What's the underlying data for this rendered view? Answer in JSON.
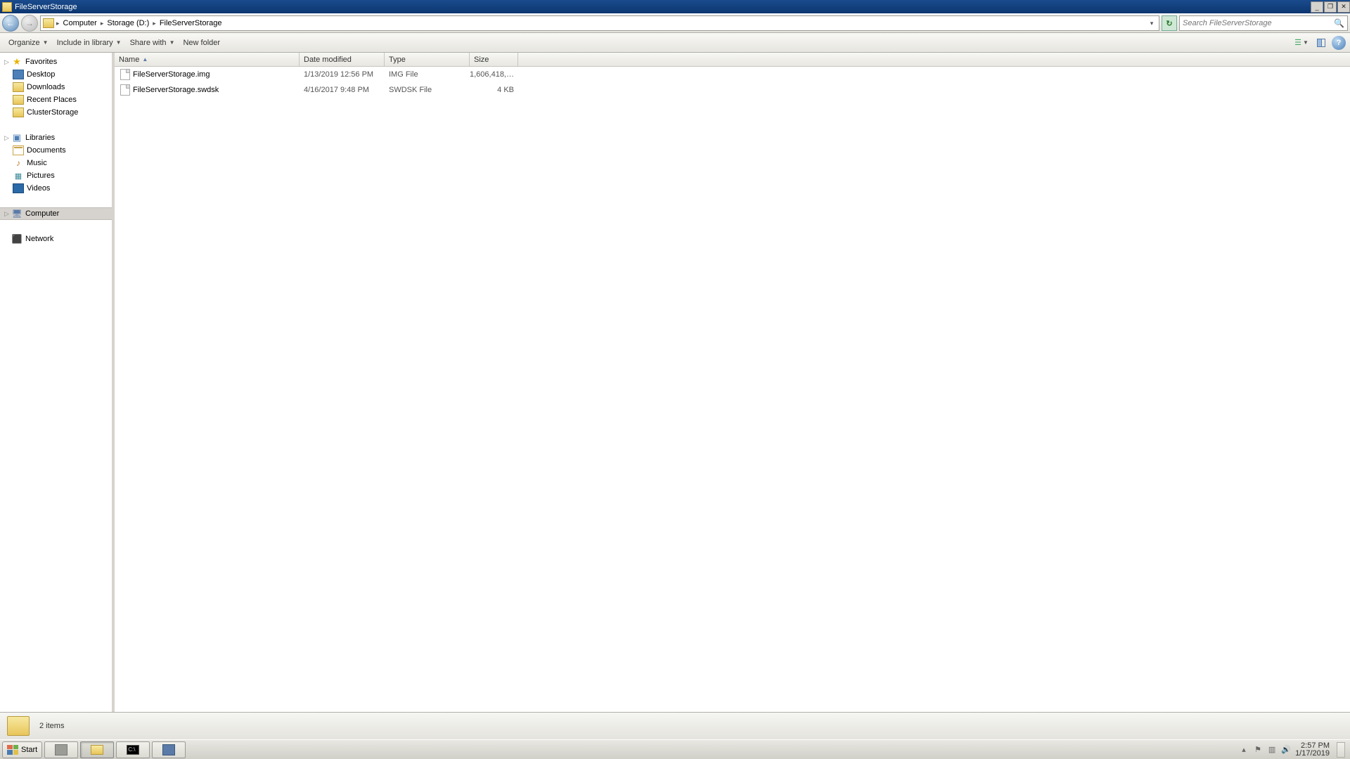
{
  "title": "FileServerStorage",
  "breadcrumb": {
    "root": "Computer",
    "drive": "Storage (D:)",
    "folder": "FileServerStorage"
  },
  "search": {
    "placeholder": "Search FileServerStorage"
  },
  "toolbar": {
    "organize": "Organize",
    "include": "Include in library",
    "share": "Share with",
    "newfolder": "New folder"
  },
  "nav": {
    "favorites": {
      "label": "Favorites",
      "items": [
        {
          "label": "Desktop",
          "icon": "desktop"
        },
        {
          "label": "Downloads",
          "icon": "folder"
        },
        {
          "label": "Recent Places",
          "icon": "recent"
        },
        {
          "label": "ClusterStorage",
          "icon": "folder"
        }
      ]
    },
    "libraries": {
      "label": "Libraries",
      "items": [
        {
          "label": "Documents",
          "icon": "doc"
        },
        {
          "label": "Music",
          "icon": "music"
        },
        {
          "label": "Pictures",
          "icon": "pic"
        },
        {
          "label": "Videos",
          "icon": "vid"
        }
      ]
    },
    "computer": {
      "label": "Computer"
    },
    "network": {
      "label": "Network"
    }
  },
  "columns": {
    "name": "Name",
    "date": "Date modified",
    "type": "Type",
    "size": "Size"
  },
  "files": [
    {
      "name": "FileServerStorage.img",
      "date": "1/13/2019 12:56 PM",
      "type": "IMG File",
      "size": "1,606,418,…"
    },
    {
      "name": "FileServerStorage.swdsk",
      "date": "4/16/2017 9:48 PM",
      "type": "SWDSK File",
      "size": "4 KB"
    }
  ],
  "details": {
    "count": "2 items"
  },
  "taskbar": {
    "start": "Start",
    "clock": {
      "time": "2:57 PM",
      "date": "1/17/2019"
    }
  }
}
